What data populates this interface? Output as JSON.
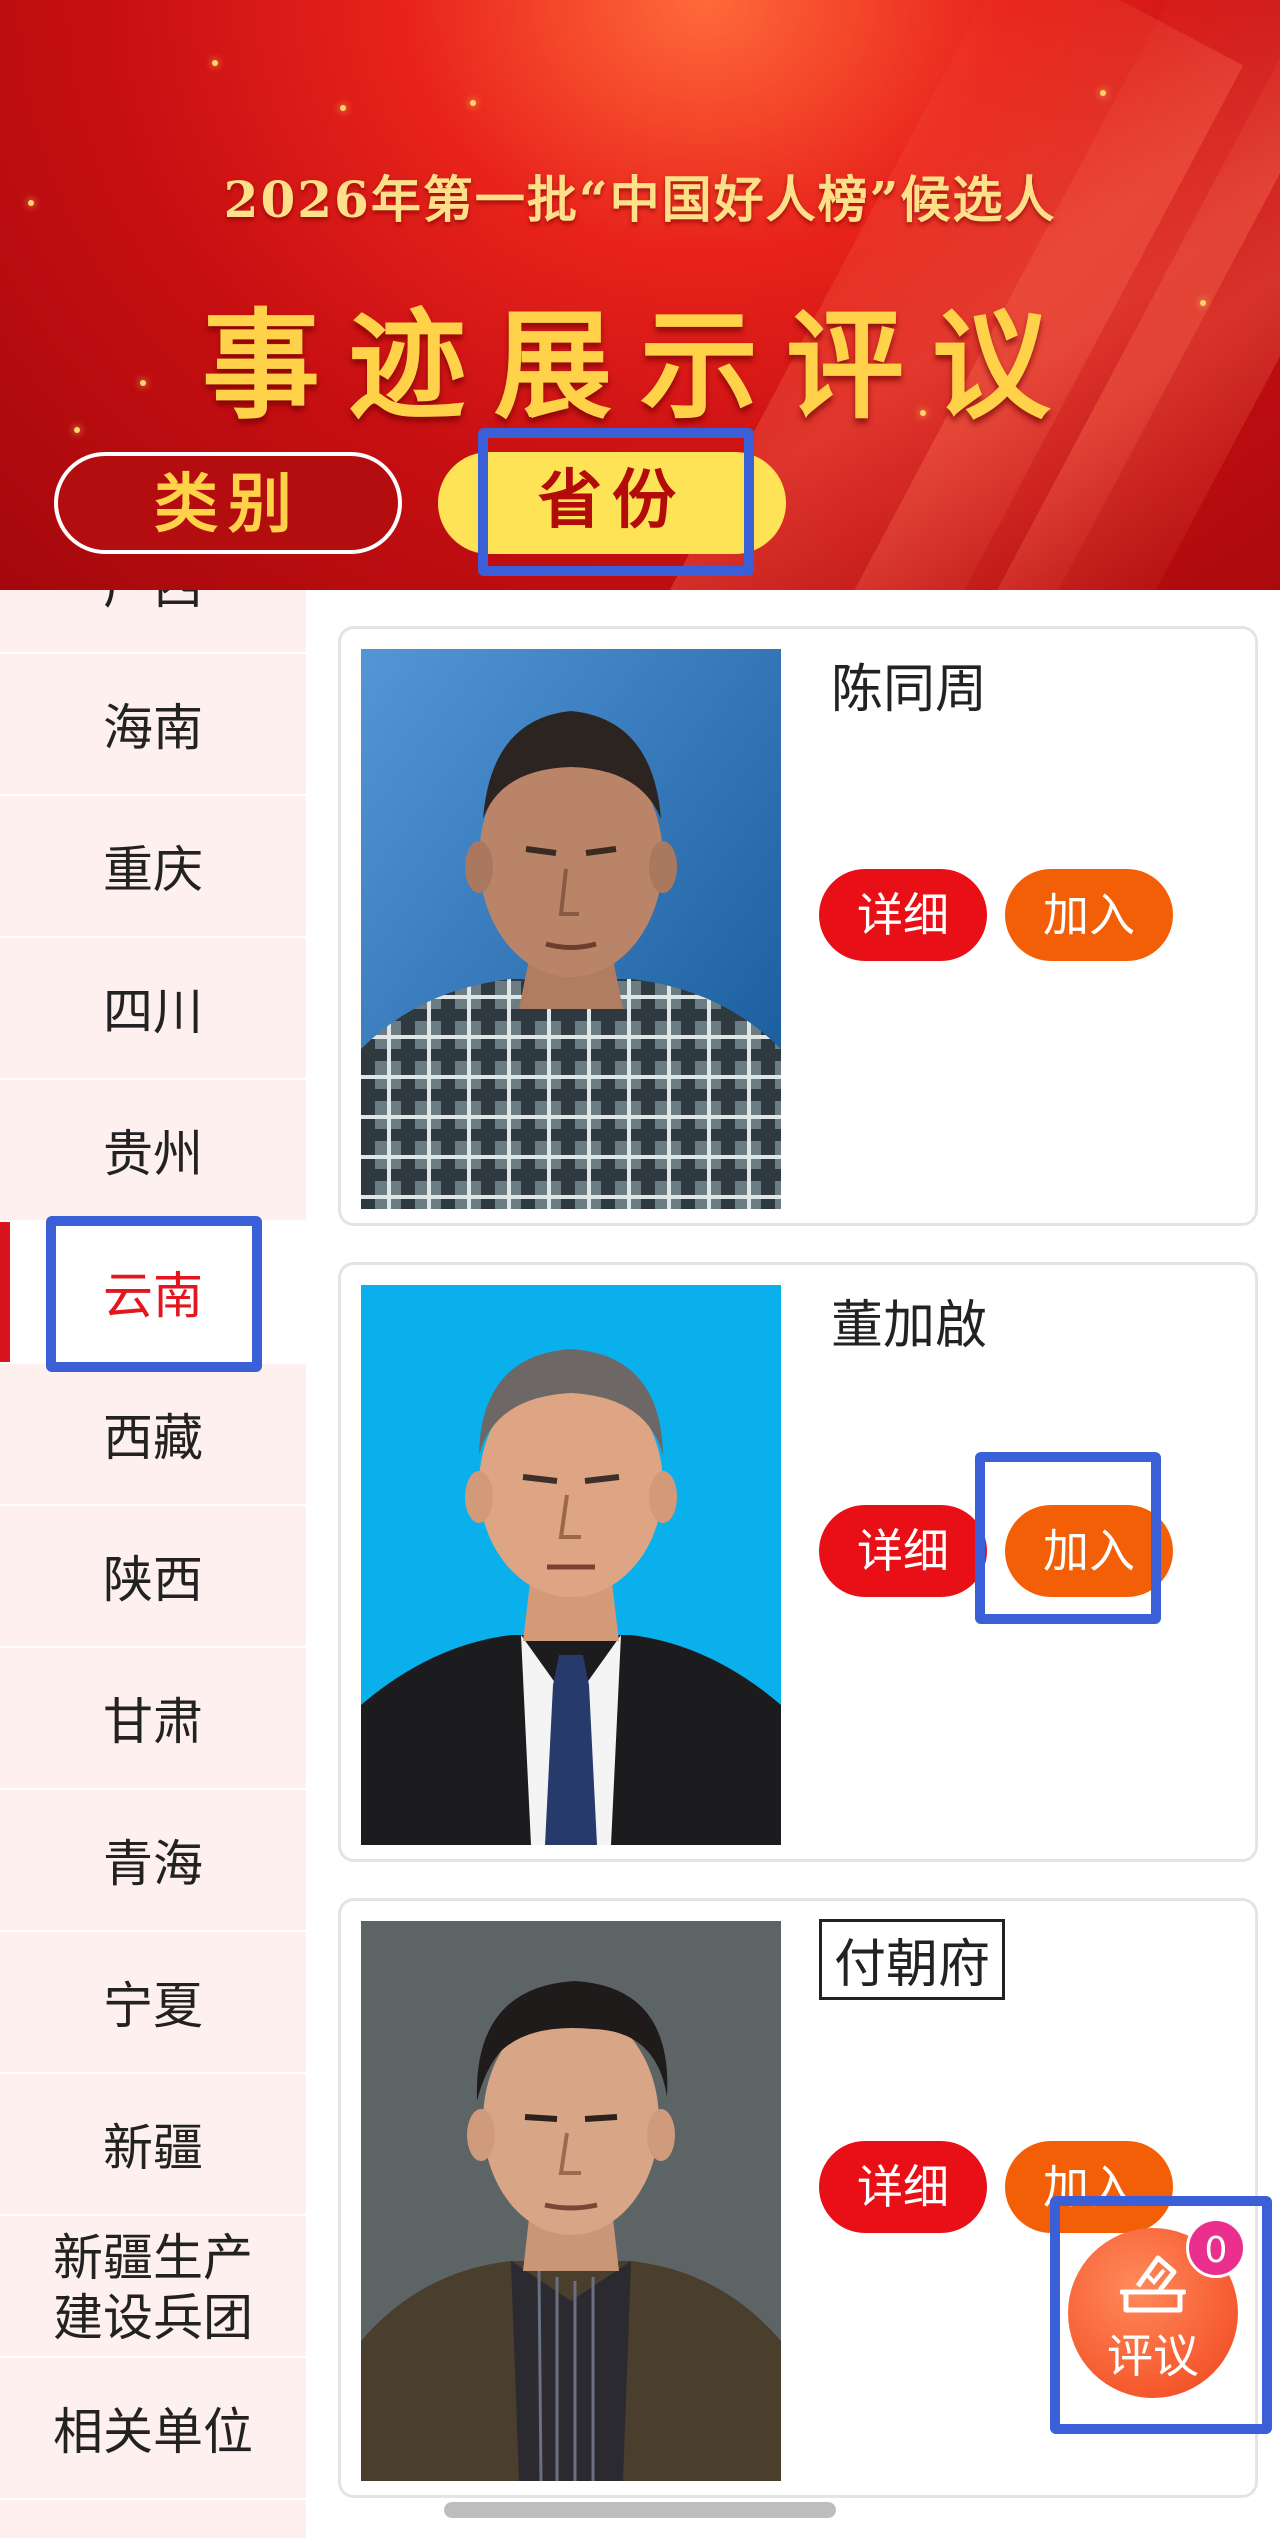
{
  "banner": {
    "line1": "2026年第一批“中国好人榜”候选人",
    "line2": "事迹展示评议"
  },
  "tabs": {
    "category": "类别",
    "province": "省份"
  },
  "sidebar": {
    "partial_top": "广西",
    "items": [
      "海南",
      "重庆",
      "四川",
      "贵州",
      "云南",
      "西藏",
      "陕西",
      "甘肃",
      "青海",
      "宁夏",
      "新疆",
      "新疆生产\n建设兵团",
      "相关单位"
    ],
    "active": "云南"
  },
  "candidates": [
    {
      "name": "陈同周",
      "detail_label": "详细",
      "join_label": "加入"
    },
    {
      "name": "董加啟",
      "detail_label": "详细",
      "join_label": "加入"
    },
    {
      "name": "付朝府",
      "detail_label": "详细",
      "join_label": "加入"
    }
  ],
  "fab": {
    "label": "评议",
    "badge": "0"
  },
  "colors": {
    "primary_red": "#e80f16",
    "join_orange": "#f25f06",
    "highlight_blue": "#3b5fd6"
  }
}
